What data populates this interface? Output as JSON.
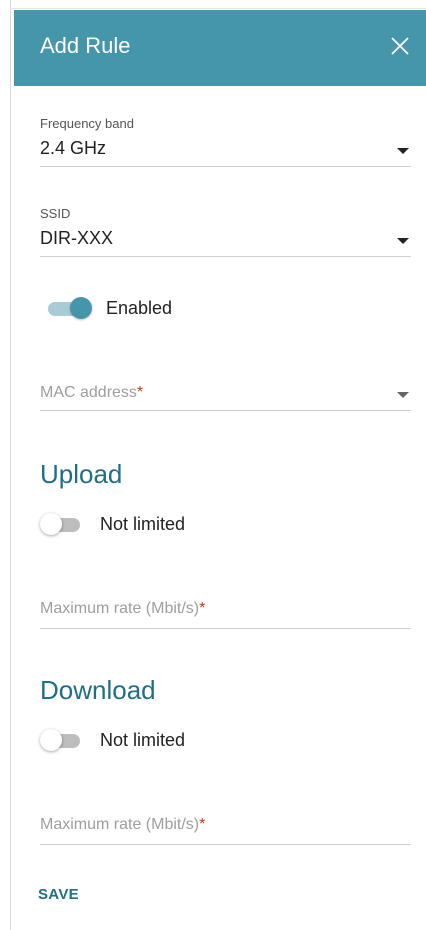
{
  "dialog": {
    "title": "Add Rule",
    "close_icon": "close-icon"
  },
  "frequency_band": {
    "label": "Frequency band",
    "value": "2.4 GHz"
  },
  "ssid": {
    "label": "SSID",
    "value": "DIR-XXX"
  },
  "enabled_toggle": {
    "label": "Enabled",
    "state": true
  },
  "mac_address": {
    "placeholder": "MAC address",
    "required_mark": "*"
  },
  "upload": {
    "title": "Upload",
    "toggle_label": "Not limited",
    "toggle_state": false,
    "max_rate_placeholder": "Maximum rate (Mbit/s)",
    "required_mark": "*"
  },
  "download": {
    "title": "Download",
    "toggle_label": "Not limited",
    "toggle_state": false,
    "max_rate_placeholder": "Maximum rate (Mbit/s)",
    "required_mark": "*"
  },
  "actions": {
    "save_label": "SAVE"
  },
  "colors": {
    "header": "#4596ab",
    "accent": "#1f6f86",
    "required": "#d3361f"
  }
}
